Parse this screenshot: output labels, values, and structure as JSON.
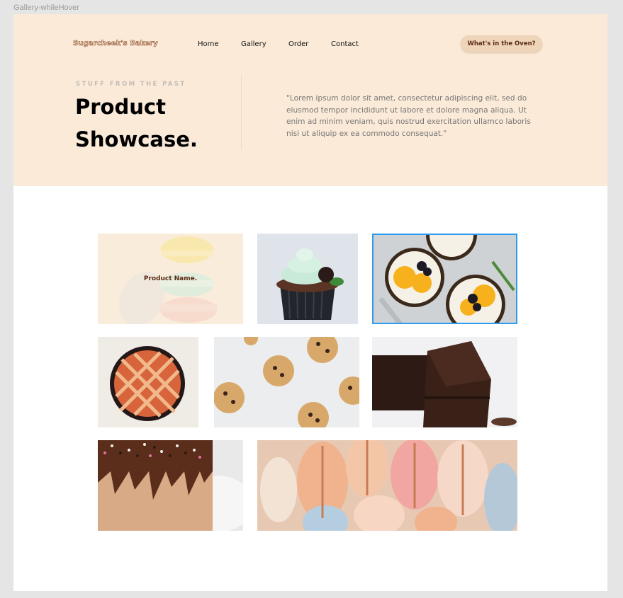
{
  "frame_label": "Gallery-whileHover",
  "nav": {
    "logo": "Sugarcheek's Bakery",
    "links": [
      "Home",
      "Gallery",
      "Order",
      "Contact"
    ],
    "cta_label": "What's in the Oven?"
  },
  "hero": {
    "eyebrow": "STUFF FROM THE PAST",
    "title_line1": "Product",
    "title_line2": "Showcase.",
    "quote": "\"Lorem ipsum dolor sit amet, consectetur adipiscing elit, sed do eiusmod tempor incididunt ut labore et dolore magna aliqua. Ut enim ad minim veniam, quis nostrud exercitation ullamco laboris nisi ut aliquip ex ea commodo consequat.\""
  },
  "gallery": {
    "hover_label": "Product Name.",
    "items": [
      "macarons-stack",
      "cupcake",
      "fruit-tarts",
      "lattice-pie",
      "cookies",
      "brownies",
      "drip-cake",
      "macarons-pile"
    ]
  },
  "colors": {
    "hero_bg": "#fbead8",
    "cta_bg": "#eed4b8",
    "brand_brown": "#5a2a14",
    "selection": "#2d9cf0"
  }
}
